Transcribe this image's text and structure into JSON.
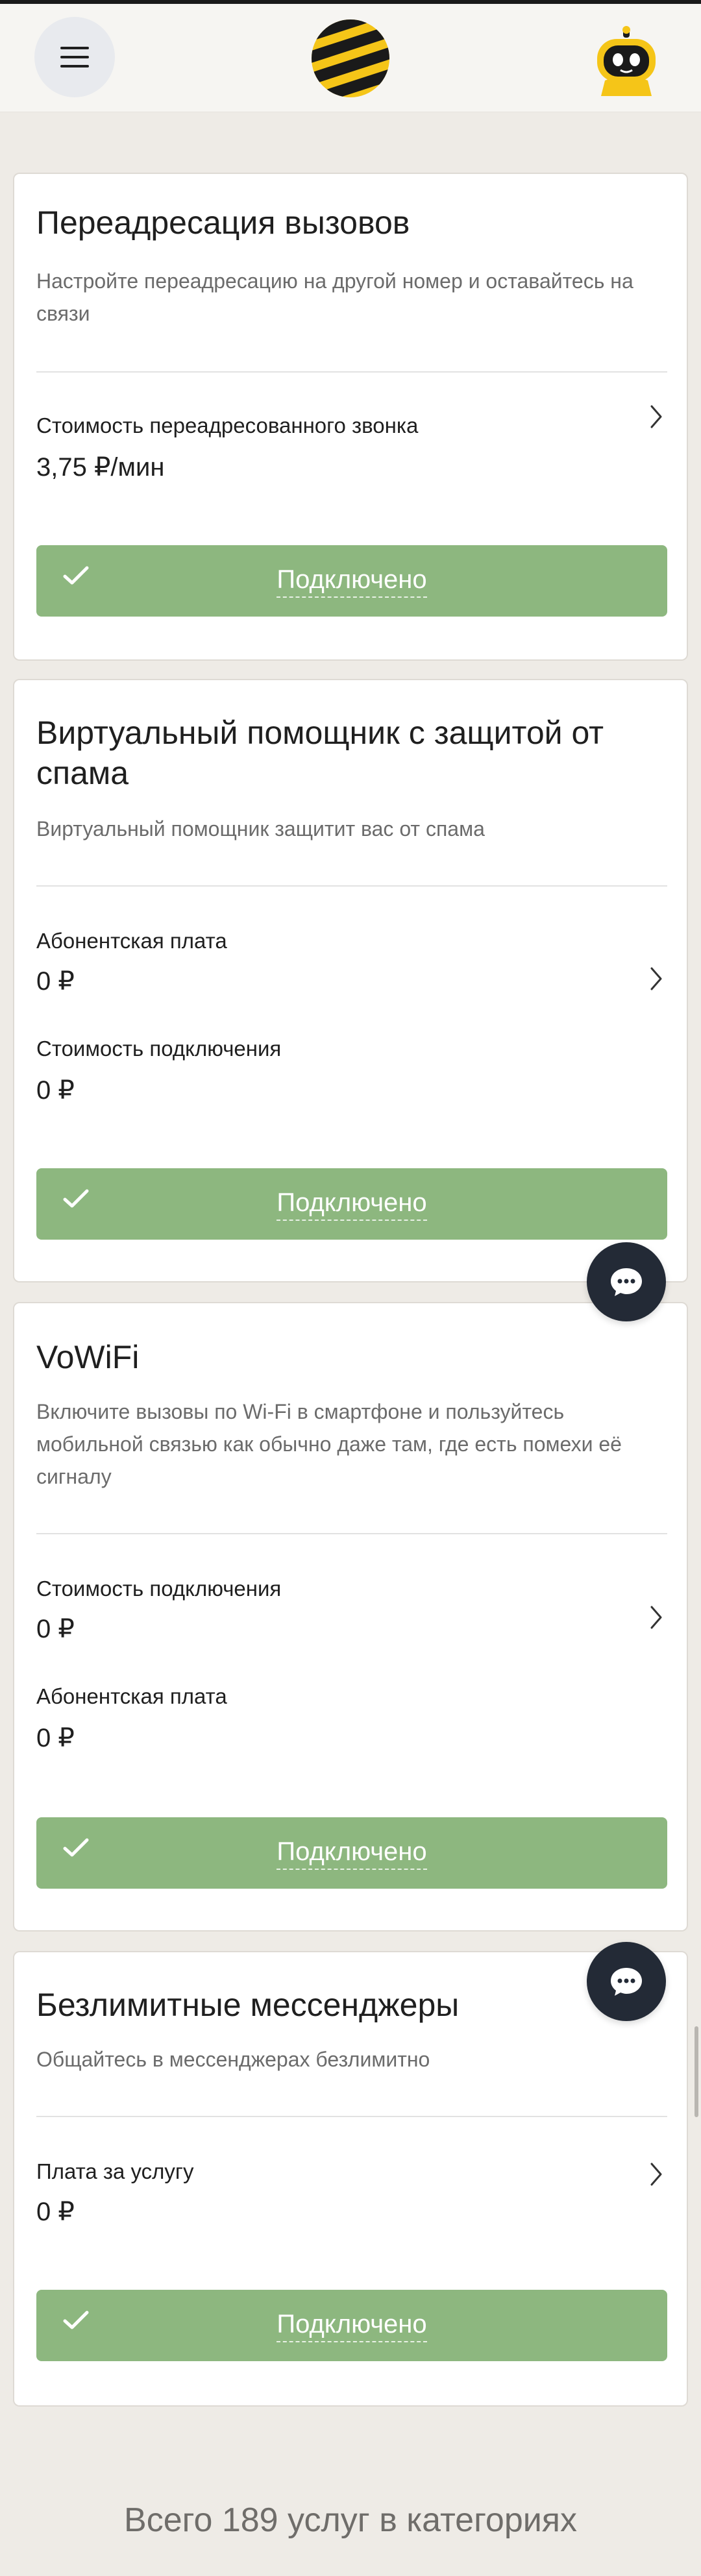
{
  "header": {
    "menu_icon": "hamburger-menu-icon",
    "logo": "beeline-striped-ball-logo",
    "avatar": "robot-assistant-avatar"
  },
  "cards": [
    {
      "title": "Переадресация вызовов",
      "description": "Настройте переадресацию на другой номер и оставайтесь на связи",
      "prices": [
        {
          "label": "Стоимость переадресованного звонка",
          "value": "3,75 ₽/мин"
        }
      ],
      "status_label": "Подключено"
    },
    {
      "title": "Виртуальный помощник с защитой от спама",
      "description": "Виртуальный помощник защитит вас от спама",
      "prices": [
        {
          "label": "Абонентская плата",
          "value": "0 ₽"
        },
        {
          "label": "Стоимость подключения",
          "value": "0 ₽"
        }
      ],
      "status_label": "Подключено"
    },
    {
      "title": "VoWiFi",
      "description": "Включите вызовы по Wi-Fi в смартфоне и пользуйтесь мобильной связью как обычно даже там, где есть помехи её сигналу",
      "prices": [
        {
          "label": "Стоимость подключения",
          "value": "0 ₽"
        },
        {
          "label": "Абонентская плата",
          "value": "0 ₽"
        }
      ],
      "status_label": "Подключено"
    },
    {
      "title": "Безлимитные мессенджеры",
      "description": "Общайтесь в мессенджерах безлимитно",
      "prices": [
        {
          "label": "Плата за услугу",
          "value": "0 ₽"
        }
      ],
      "status_label": "Подключено"
    }
  ],
  "chat_icon": "chat-bubble-icon",
  "footer": {
    "title": "Всего 189 услуг в категориях"
  },
  "colors": {
    "connected_button": "#8db77f",
    "page_background": "#eeebe6",
    "chat_button": "#232a36",
    "brand_yellow": "#f5c518"
  }
}
